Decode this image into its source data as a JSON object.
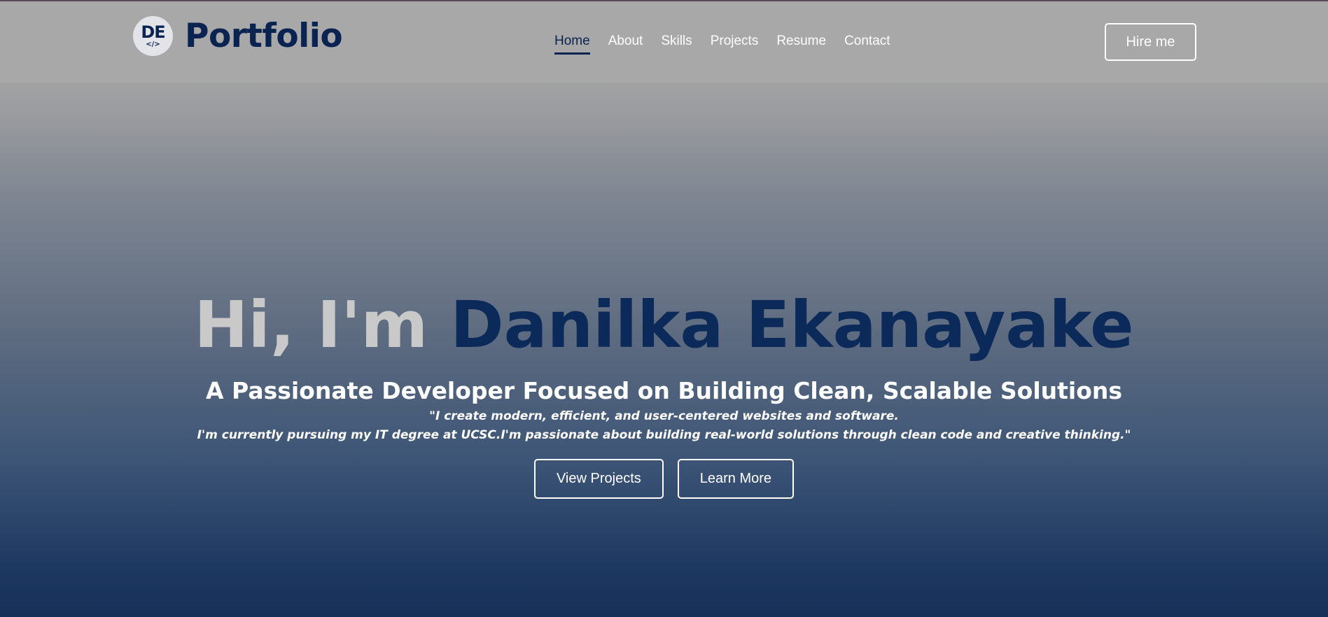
{
  "brand": {
    "logo_initials": "DE",
    "logo_code": "</>",
    "title": "Portfolio"
  },
  "nav": {
    "items": [
      {
        "label": "Home",
        "active": true
      },
      {
        "label": "About",
        "active": false
      },
      {
        "label": "Skills",
        "active": false
      },
      {
        "label": "Projects",
        "active": false
      },
      {
        "label": "Resume",
        "active": false
      },
      {
        "label": "Contact",
        "active": false
      }
    ]
  },
  "header": {
    "hire_label": "Hire me"
  },
  "hero": {
    "greeting": "Hi, I'm",
    "name": "Danilka Ekanayake",
    "subtitle": "A Passionate Developer Focused on Building Clean, Scalable Solutions",
    "quote_line1": "\"I create modern, efficient, and user-centered websites and software.",
    "quote_line2": "I'm currently pursuing my IT degree at UCSC.I'm passionate about building real-world solutions through clean code and creative thinking.\"",
    "view_projects_label": "View Projects",
    "learn_more_label": "Learn More"
  },
  "colors": {
    "brand_navy": "#0b2350",
    "greeting_gray": "#c9c9c9",
    "header_bg": "#a8a8a8"
  }
}
